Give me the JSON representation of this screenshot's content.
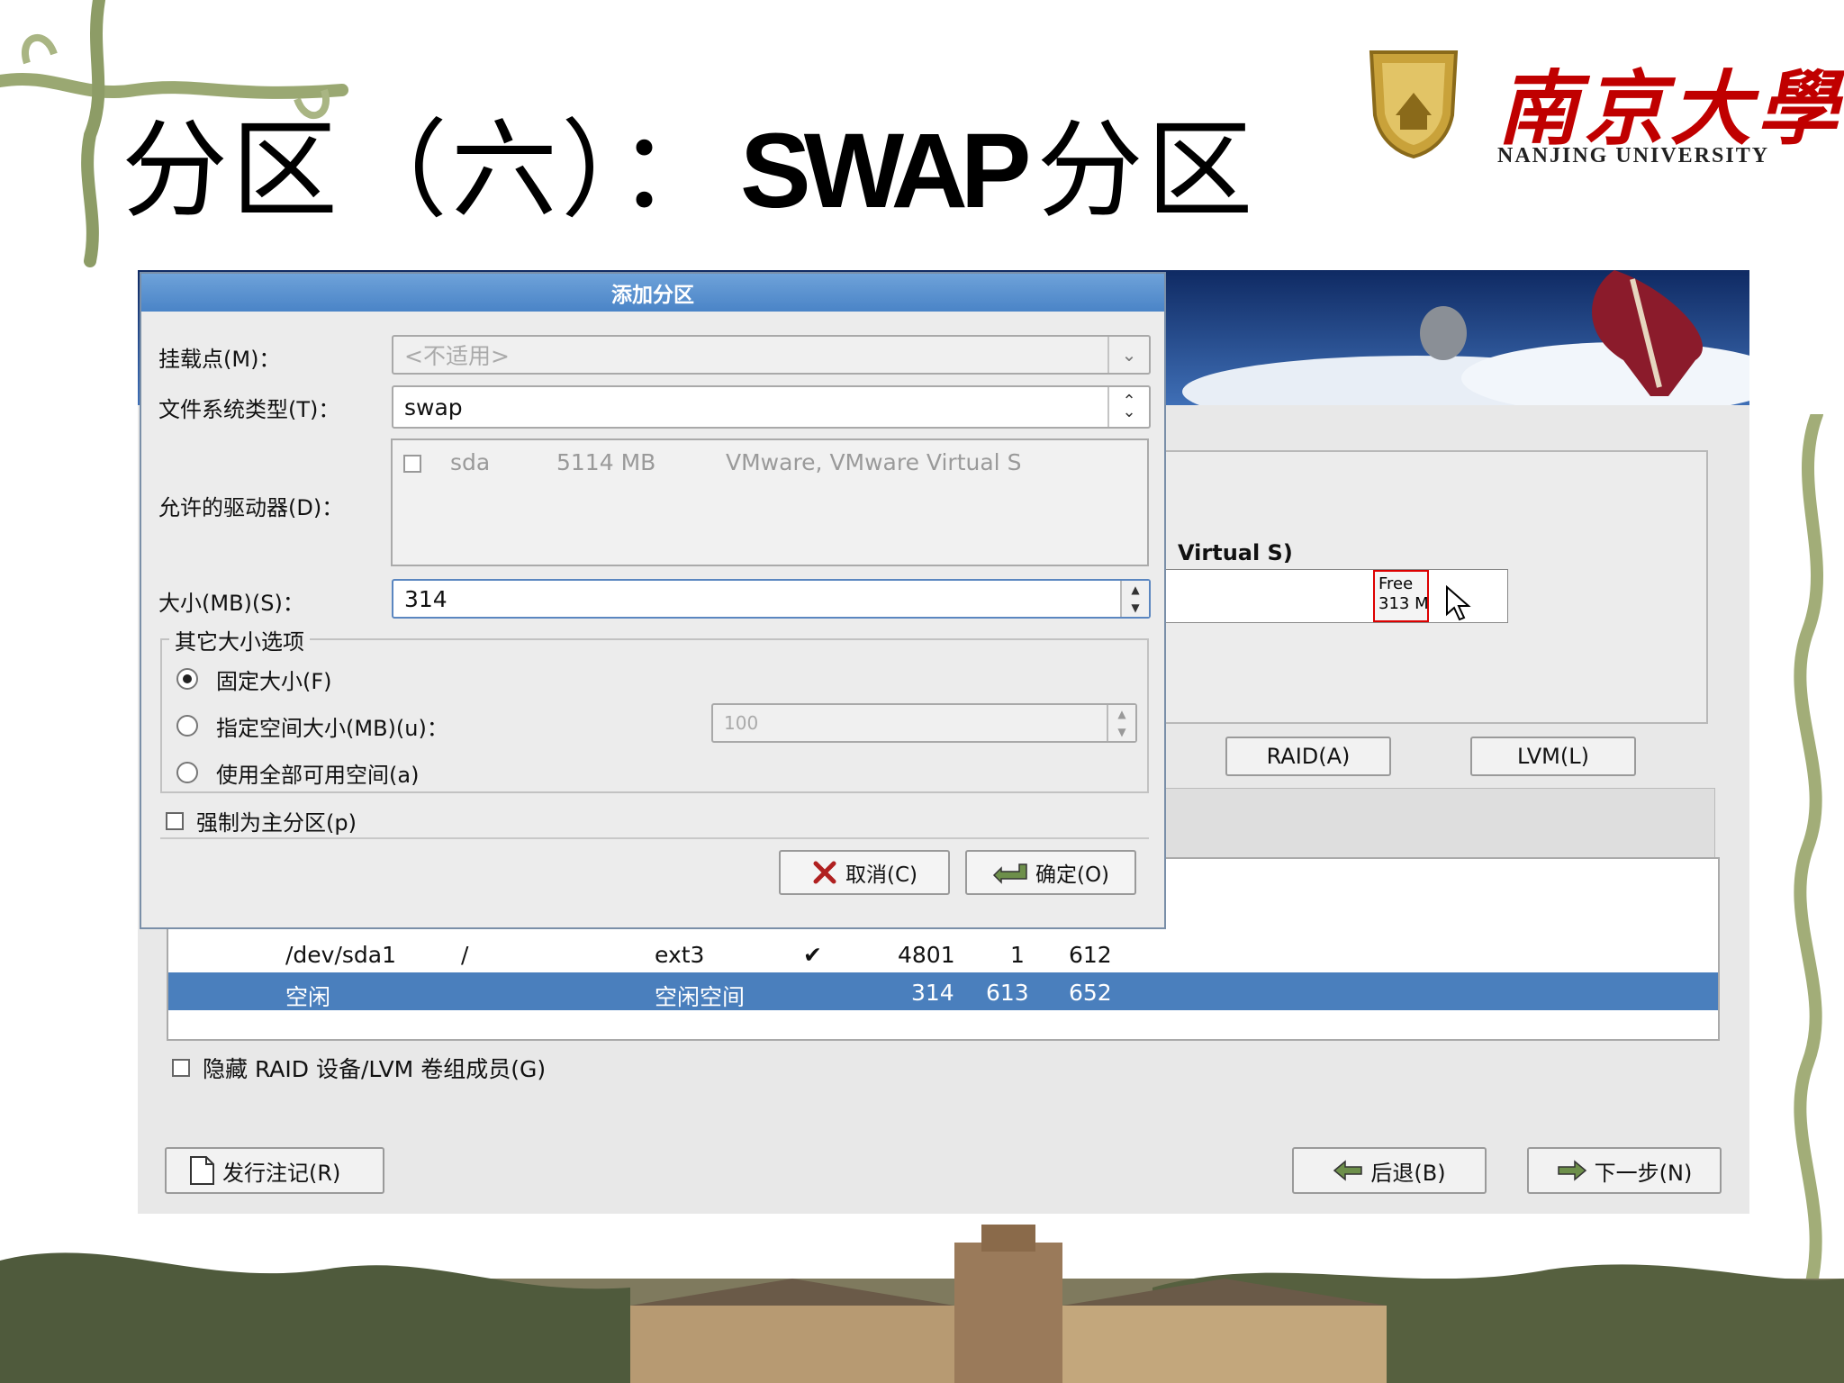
{
  "slide": {
    "title_cn_1": "分区（六）：",
    "title_latin": "SWAP",
    "title_cn_2": "分区",
    "university_cn": "南京大學",
    "university_en": "NANJING UNIVERSITY"
  },
  "dialog": {
    "title": "添加分区",
    "mount_label": "挂载点(M)：",
    "mount_value": "<不适用>",
    "fstype_label": "文件系统类型(T)：",
    "fstype_value": "swap",
    "drives_label": "允许的驱动器(D)：",
    "drive": {
      "name": "sda",
      "size": "5114 MB",
      "model": "VMware, VMware Virtual S"
    },
    "size_label": "大小(MB)(S)：",
    "size_value": "314",
    "other_options_legend": "其它大小选项",
    "opt_fixed": "固定大小(F)",
    "opt_upto": "指定空间大小(MB)(u)：",
    "opt_upto_value": "100",
    "opt_fill": "使用全部可用空间(a)",
    "force_primary": "强制为主分区(p)",
    "cancel": "取消(C)",
    "ok": "确定(O)"
  },
  "background": {
    "disk_label": "Virtual S)",
    "free_label": "Free",
    "free_size": "313 M",
    "raid_button": "RAID(A)",
    "lvm_button": "LVM(L)",
    "rows": [
      {
        "device": "/dev/sda1",
        "mount": "/",
        "type": "ext3",
        "format": "✔",
        "size": "4801",
        "start": "1",
        "end": "612"
      },
      {
        "device": "空闲",
        "mount": "",
        "type": "空闲空间",
        "format": "",
        "size": "314",
        "start": "613",
        "end": "652"
      }
    ],
    "hide_raid": "隐藏 RAID 设备/LVM 卷组成员(G)",
    "release_notes": "发行注记(R)",
    "back": "后退(B)",
    "next": "下一步(N)"
  },
  "colors": {
    "title_bar": "#4a84c7",
    "selection": "#4a7fbd",
    "university_red": "#c00000"
  }
}
